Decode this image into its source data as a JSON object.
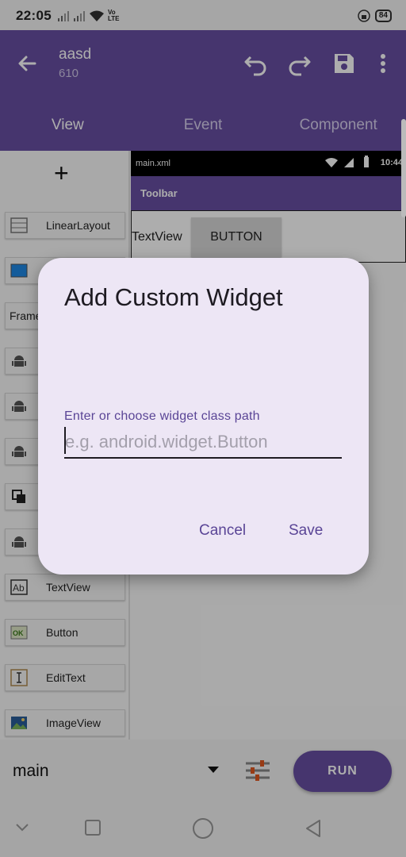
{
  "status_bar": {
    "time": "22:05",
    "network_label": "Vo LTE",
    "battery": "84"
  },
  "app_bar": {
    "title": "aasd",
    "subtitle": "610",
    "back_icon": "arrow-back-icon",
    "actions": [
      "undo-icon",
      "redo-icon",
      "save-icon",
      "more-vert-icon"
    ]
  },
  "tabs": [
    {
      "label": "View",
      "active": true
    },
    {
      "label": "Event",
      "active": false
    },
    {
      "label": "Component",
      "active": false
    }
  ],
  "palette": {
    "add_icon": "plus-icon",
    "items": [
      {
        "label": "LinearLayout",
        "icon": "linear-layout-icon"
      },
      {
        "label": "",
        "icon": "scroll-view-icon"
      },
      {
        "label": "Frame",
        "icon": ""
      },
      {
        "label": "",
        "icon": "android-icon"
      },
      {
        "label": "",
        "icon": "android-icon"
      },
      {
        "label": "",
        "icon": "android-icon"
      },
      {
        "label": "",
        "icon": "copy-icon"
      },
      {
        "label": "",
        "icon": "android-icon"
      },
      {
        "label": "TextView",
        "icon": "textview-icon"
      },
      {
        "label": "Button",
        "icon": "button-icon"
      },
      {
        "label": "EditText",
        "icon": "edittext-icon"
      },
      {
        "label": "ImageView",
        "icon": "imageview-icon"
      }
    ]
  },
  "preview": {
    "file_name": "main.xml",
    "time": "10:44",
    "toolbar_title": "Toolbar",
    "textview_text": "TextView",
    "button_text": "BUTTON"
  },
  "bottom_bar": {
    "layout_name": "main",
    "run_label": "RUN"
  },
  "dialog": {
    "title": "Add Custom Widget",
    "field_label": "Enter or choose widget class path",
    "field_value": "",
    "field_placeholder": "e.g. android.widget.Button",
    "cancel_label": "Cancel",
    "save_label": "Save"
  },
  "colors": {
    "primary": "#674fa3",
    "dialog_bg": "#ede6f5",
    "accent_text": "#5a4596"
  }
}
